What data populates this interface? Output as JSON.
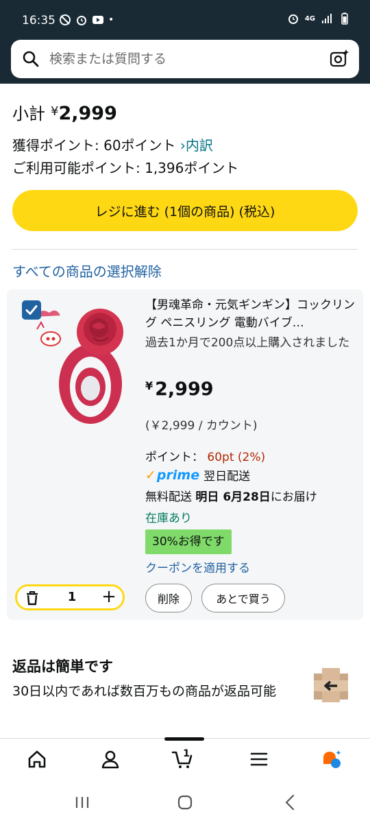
{
  "status_bar": {
    "time": "16:35",
    "dot": "•",
    "network": "4G",
    "icons": [
      "no-call-icon",
      "alarm-icon",
      "youtube-icon",
      "alarm-icon",
      "signal-icon",
      "battery-icon"
    ]
  },
  "search": {
    "placeholder": "検索または質問する"
  },
  "summary": {
    "subtotal_label": "小計",
    "currency": "¥",
    "subtotal_amount": "2,999",
    "earned_points_text": "獲得ポイント: 60ポイント",
    "breakdown_link": "›内訳",
    "available_points_text": "ご利用可能ポイント: 1,396ポイント",
    "checkout_label": "レジに進む (1個の商品) (税込)"
  },
  "deselect_all": "すべての商品の選択解除",
  "item": {
    "checked": true,
    "title": "【男魂革命・元気ギンギン】コックリング ペニスリング 電動バイブ…",
    "bought_note": "過去1か月で200点以上購入されました",
    "currency": "¥",
    "price": "2,999",
    "unit_price": "(￥2,999 / カウント)",
    "points_label": "ポイント：",
    "points_value": "60pt (2%)",
    "prime_label": "prime",
    "prime_delivery": "翌日配送",
    "shipping_prefix": "無料配送",
    "shipping_date": "明日 6月28日",
    "shipping_suffix": "にお届け",
    "stock_status": "在庫あり",
    "discount_badge": "30%お得です",
    "coupon_link": "クーポンを適用する",
    "quantity": "1",
    "delete_label": "削除",
    "save_later_label": "あとで買う"
  },
  "returns": {
    "title": "返品は簡単です",
    "description": "30日以内であれば数百万もの商品が返品可能"
  },
  "bottom_nav": {
    "items": [
      "home-icon",
      "account-icon",
      "cart-icon",
      "menu-icon",
      "rufus-icon"
    ],
    "cart_count": "1"
  },
  "colors": {
    "header_bg": "#1a2a35",
    "checkout_yellow": "#ffd814",
    "link_blue": "#2162a1",
    "stock_green": "#067d62",
    "points_red": "#b12704",
    "discount_green": "#7fda69"
  }
}
